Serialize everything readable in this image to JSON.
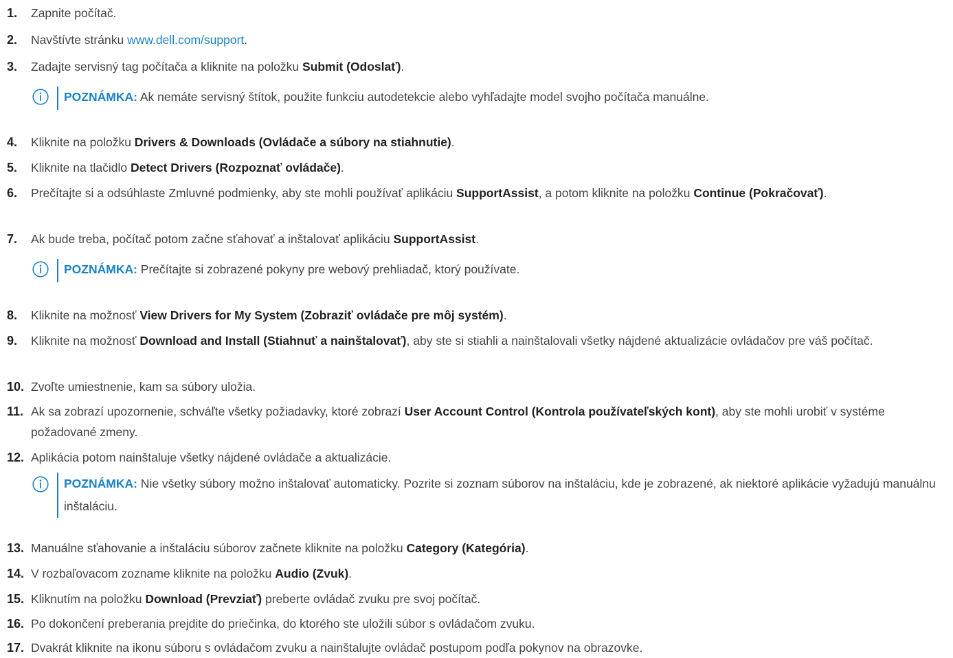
{
  "steps": [
    {
      "n": "1.",
      "parts": [
        "Zapnite počítač."
      ]
    },
    {
      "n": "2.",
      "pre": "Navštívte stránku ",
      "link": "www.dell.com/support",
      "post": "."
    },
    {
      "n": "3.",
      "pre": "Zadajte servisný tag počítača a kliknite na položku ",
      "bold": "Submit (Odoslať)",
      "post": "."
    },
    {
      "n": "4.",
      "pre": "Kliknite na položku ",
      "bold": "Drivers & Downloads (Ovládače a súbory na stiahnutie)",
      "post": "."
    },
    {
      "n": "5.",
      "pre": "Kliknite na tlačidlo ",
      "bold": "Detect Drivers (Rozpoznať ovládače)",
      "post": "."
    },
    {
      "n": "6.",
      "pre": "Prečítajte si a odsúhlaste Zmluvné podmienky, aby ste mohli používať aplikáciu ",
      "bold": "SupportAssist",
      "mid": ", a potom kliknite na položku ",
      "bold2": "Continue (Pokračovať)",
      "post": "."
    },
    {
      "n": "7.",
      "pre": "Ak bude treba, počítač potom začne sťahovať a inštalovať aplikáciu ",
      "bold": "SupportAssist",
      "post": "."
    },
    {
      "n": "8.",
      "pre": "Kliknite na možnosť ",
      "bold": "View Drivers for My System (Zobraziť ovládače pre môj systém)",
      "post": "."
    },
    {
      "n": "9.",
      "pre": "Kliknite na možnosť ",
      "bold": "Download and Install (Stiahnuť a nainštalovať)",
      "post": ", aby ste si stiahli a nainštalovali všetky nájdené aktualizácie ovládačov pre váš počítač."
    },
    {
      "n": "10.",
      "pre": "Zvoľte umiestnenie, kam sa súbory uložia."
    },
    {
      "n": "11.",
      "pre": "Ak sa zobrazí upozornenie, schváľte všetky požiadavky, ktoré zobrazí ",
      "bold": "User Account Control (Kontrola používateľských kont)",
      "post": ", aby ste mohli urobiť v systéme požadované zmeny."
    },
    {
      "n": "12.",
      "pre": "Aplikácia potom nainštaluje všetky nájdené ovládače a aktualizácie."
    },
    {
      "n": "13.",
      "pre": "Manuálne sťahovanie a inštaláciu súborov začnete kliknite na položku ",
      "bold": "Category (Kategória)",
      "post": "."
    },
    {
      "n": "14.",
      "pre": "V rozbaľovacom zozname kliknite na položku ",
      "bold": "Audio (Zvuk)",
      "post": "."
    },
    {
      "n": "15.",
      "pre": "Kliknutím na položku ",
      "bold": "Download (Prevziať)",
      "post": " preberte ovládač zvuku pre svoj počítač."
    },
    {
      "n": "16.",
      "pre": "Po dokončení preberania prejdite do priečinka, do ktorého ste uložili súbor s ovládačom zvuku."
    },
    {
      "n": "17.",
      "pre": "Dvakrát kliknite na ikonu súboru s ovládačom zvuku a nainštalujte ovládač postupom podľa pokynov na obrazovke."
    }
  ],
  "notes": [
    {
      "label": "POZNÁMKA:",
      "text": " Ak nemáte servisný štítok, použite funkciu autodetekcie alebo vyhľadajte model svojho počítača manuálne."
    },
    {
      "label": "POZNÁMKA:",
      "text": " Prečítajte si zobrazené pokyny pre webový prehliadač, ktorý používate."
    },
    {
      "label": "POZNÁMKA:",
      "text": " Nie všetky súbory možno inštalovať automaticky. Pozrite si zoznam súborov na inštaláciu, kde je zobrazené, ak niektoré aplikácie vyžadujú manuálnu inštaláciu."
    }
  ],
  "colors": {
    "accent": "#1a82c6",
    "text": "#444444",
    "strong": "#222222"
  },
  "icons": {
    "note": "info-circle-icon"
  }
}
